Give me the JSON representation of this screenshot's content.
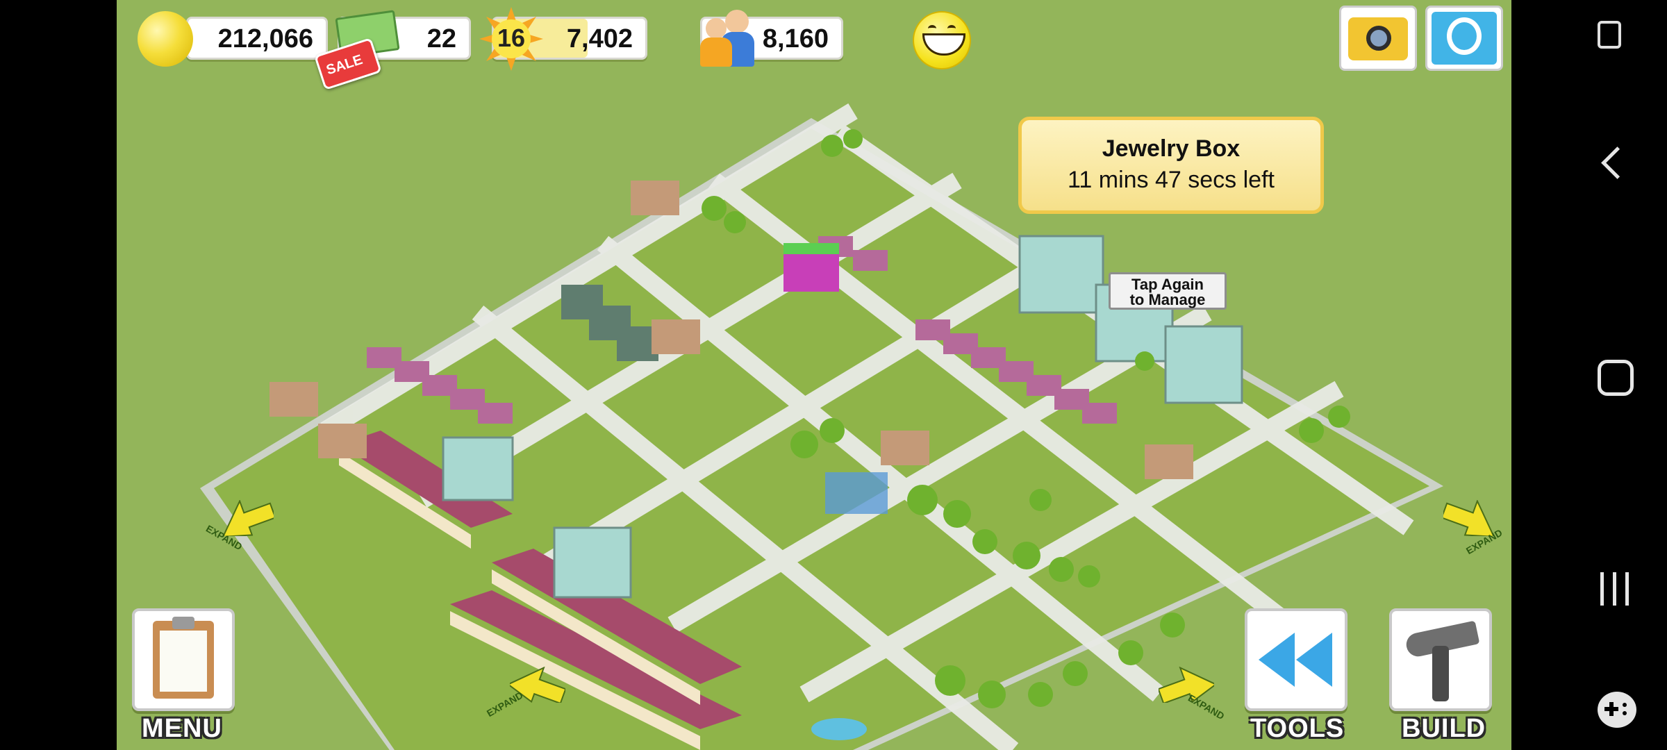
{
  "hud": {
    "coins": "212,066",
    "cash": "22",
    "sale_badge": "SALE",
    "level": "16",
    "xp": "7,402",
    "population": "8,160"
  },
  "tooltip": {
    "title": "Jewelry Box",
    "time_left": "11 mins 47 secs left"
  },
  "sign": {
    "line1": "Tap Again",
    "line2": "to Manage"
  },
  "expand_label": "EXPAND",
  "buttons": {
    "menu": "MENU",
    "tools": "TOOLS",
    "build": "BUILD"
  },
  "icons": {
    "coins": "coin-icon",
    "cash": "cash-icon",
    "level": "star-burst-icon",
    "population": "people-icon",
    "happiness": "smiley-icon",
    "camera": "camera-icon",
    "share": "share-icon"
  }
}
